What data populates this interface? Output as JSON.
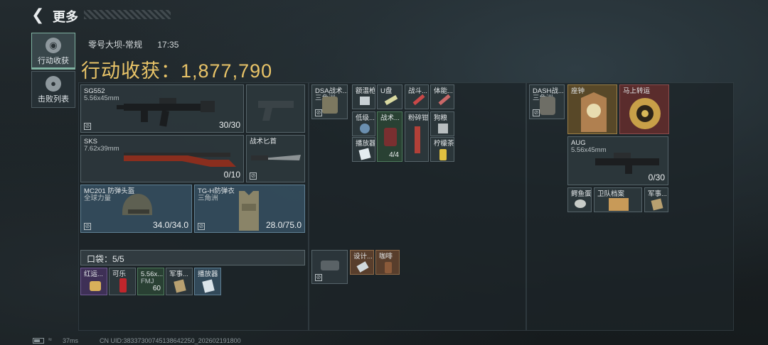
{
  "header": {
    "back_icon": "back-arrow-icon",
    "title": "更多"
  },
  "tabs": [
    {
      "label": "行动收获",
      "icon": "badge-icon",
      "active": true
    },
    {
      "label": "击败列表",
      "icon": "skull-icon",
      "active": false
    }
  ],
  "match": {
    "map": "零号大坝-常规",
    "time": "17:35"
  },
  "gain": {
    "label": "行动收获：",
    "value": "1,877,790"
  },
  "weapons": [
    {
      "name": "SG552",
      "sub": "5.56x45mm",
      "count": "30/30"
    },
    {
      "name": "SKS",
      "sub": "7.62x39mm",
      "count": "0/10"
    }
  ],
  "pistol_slot": {
    "name": ""
  },
  "knife": {
    "name": "战术匕首"
  },
  "helmet": {
    "name": "MC201 防弹头盔",
    "sub": "全球力量",
    "count": "34.0/34.0"
  },
  "armor": {
    "name": "TG-H防弹衣",
    "sub": "三角洲",
    "count": "28.0/75.0"
  },
  "rig": {
    "name": "DSA战术...",
    "sub": "三角洲"
  },
  "rig_items": [
    {
      "name": "额温枪"
    },
    {
      "name": "U盘"
    },
    {
      "name": "战斗..."
    },
    {
      "name": "体能..."
    },
    {
      "name": "低级..."
    },
    {
      "name": "战术...",
      "count": "4/4"
    },
    {
      "name": "粉碎钳"
    },
    {
      "name": "狗粮"
    },
    {
      "name": "播放器"
    },
    {
      "name": "柠檬茶"
    }
  ],
  "pocket": {
    "label": "口袋：",
    "value": "5/5"
  },
  "pocket_items": [
    {
      "name": "红运..."
    },
    {
      "name": "可乐"
    },
    {
      "name": "5.56x...",
      "sub": "FMJ",
      "count": "60"
    },
    {
      "name": "军事..."
    },
    {
      "name": "播放器"
    }
  ],
  "case_items": [
    {
      "name": "设计..."
    },
    {
      "name": "咖啡"
    }
  ],
  "backpack": {
    "name": "DASH战...",
    "sub": "三角洲"
  },
  "backpack_items": [
    {
      "name": "座钟"
    },
    {
      "name": "马上转运"
    }
  ],
  "aug": {
    "name": "AUG",
    "sub": "5.56x45mm",
    "count": "0/30"
  },
  "backpack_small": [
    {
      "name": "鳄鱼蛋"
    },
    {
      "name": "卫队档案"
    },
    {
      "name": "军事..."
    }
  ],
  "footer": {
    "ping": "37ms",
    "uid": "CN UID:38337300745138642250_202602191800"
  },
  "colors": {
    "gold_text": "#e9c468",
    "accent": "#7fb2a1"
  }
}
